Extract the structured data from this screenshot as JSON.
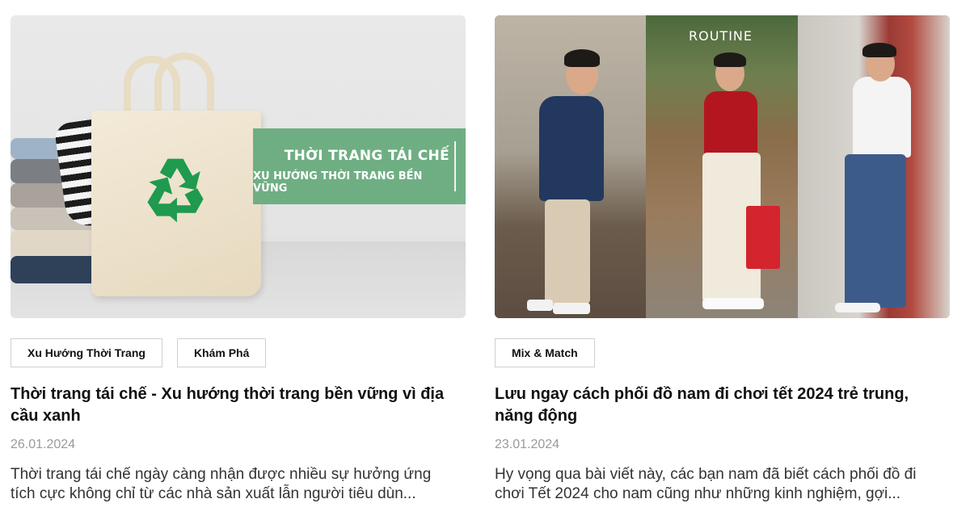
{
  "posts": [
    {
      "image": {
        "banner_title": "THỜI TRANG TÁI CHẾ",
        "banner_subtitle": "XU HƯỚNG THỜI TRANG BỀN VỮNG",
        "banner_color": "#6fae83"
      },
      "tags": [
        "Xu Hướng Thời Trang",
        "Khám Phá"
      ],
      "title": "Thời trang tái chế - Xu hướng thời trang bền vững vì địa cầu xanh",
      "date": "26.01.2024",
      "excerpt_line1": "Thời trang tái chế ngày càng nhận được nhiều sự hưởng ứng",
      "excerpt_line2": "tích cực không chỉ từ các nhà sản xuất lẫn người tiêu dùn..."
    },
    {
      "image": {
        "overlay_text": "ROUTINE"
      },
      "tags": [
        "Mix & Match"
      ],
      "title": "Lưu ngay cách phối đồ nam đi chơi tết 2024 trẻ trung, năng động",
      "date": "23.01.2024",
      "excerpt_line1": "Hy vọng qua bài viết này, các bạn nam đã biết cách phối đồ đi",
      "excerpt_line2": "chơi Tết 2024 cho nam cũng như những kinh nghiệm, gợi..."
    }
  ]
}
